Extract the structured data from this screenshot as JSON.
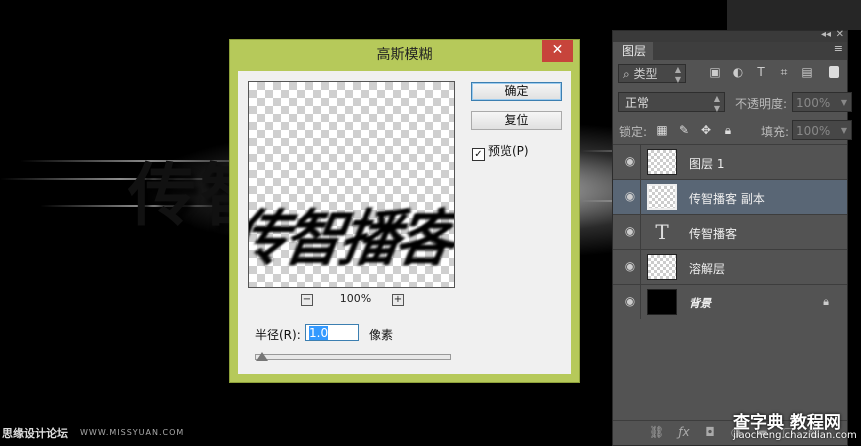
{
  "canvas": {
    "text": "传智播客"
  },
  "dialog": {
    "title": "高斯模糊",
    "close": "✕",
    "preview_text": "传智播客",
    "zoom_out": "−",
    "zoom_in": "+",
    "zoom_level": "100%",
    "ok_label": "确定",
    "reset_label": "复位",
    "preview_checkbox": {
      "label": "预览(P)",
      "checked": true,
      "mark": "✓"
    },
    "radius_label": "半径(R):",
    "radius_value": "1.0",
    "radius_unit": "像素",
    "radius_slider_fraction": 0.02
  },
  "layers_panel": {
    "collapse_icon": "◂◂",
    "close_icon": "✕",
    "tab": "图层",
    "menu_icon": "≡",
    "filter_label": "⌕ 类型",
    "blend_mode": "正常",
    "opacity_label": "不透明度:",
    "opacity_value": "100%",
    "lock_label": "锁定:",
    "fill_label": "填充:",
    "fill_value": "100%",
    "layers": [
      {
        "name": "图层 1",
        "type": "transparent",
        "selected": false,
        "locked": false
      },
      {
        "name": "传智播客 副本",
        "type": "transparent",
        "selected": true,
        "locked": false
      },
      {
        "name": "传智播客",
        "type": "text",
        "selected": false,
        "locked": false,
        "glyph": "T"
      },
      {
        "name": "溶解层",
        "type": "transparent",
        "selected": false,
        "locked": false
      },
      {
        "name": "背景",
        "type": "black",
        "selected": false,
        "locked": true
      }
    ]
  },
  "watermarks": {
    "left": "思缘设计论坛",
    "left_url": "WWW.MISSYUAN.COM",
    "right_logo": "查字典 教程网",
    "right_url": "jiaocheng.chazidian.com"
  }
}
